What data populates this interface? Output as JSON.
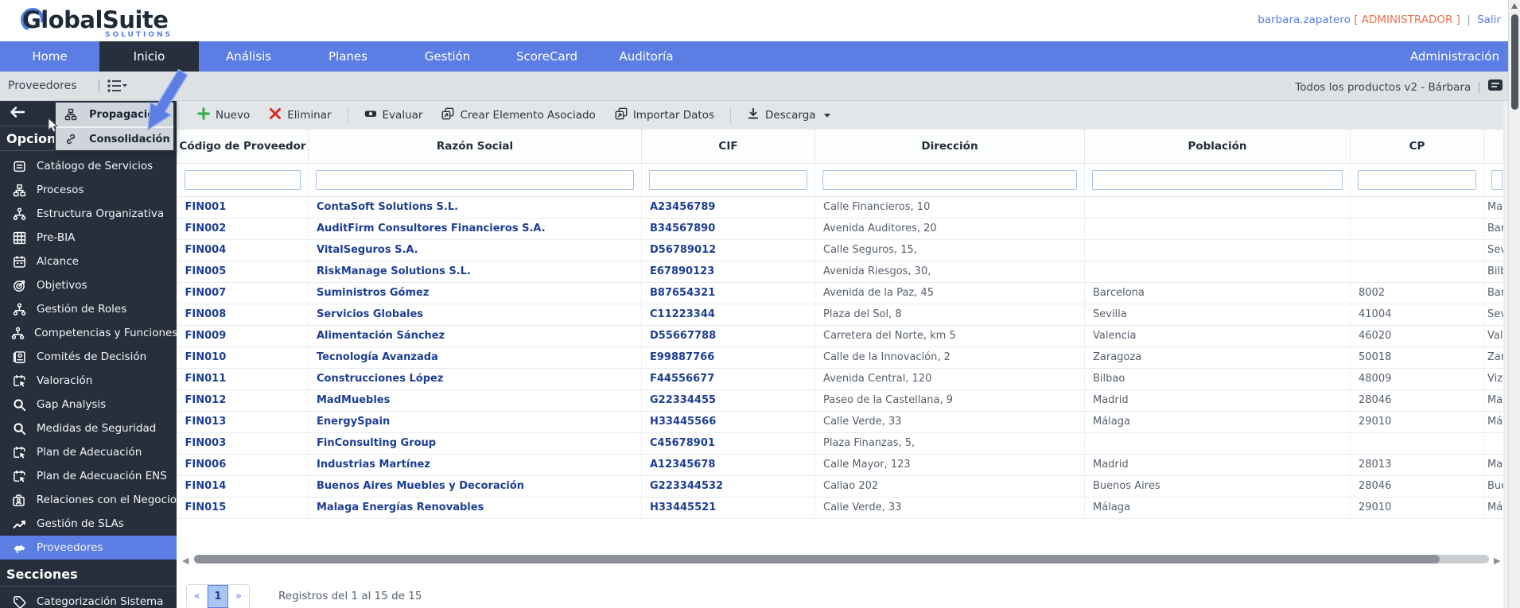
{
  "header": {
    "logo_text": "GlobalSuite",
    "logo_sub": "SOLUTIONS",
    "user": "barbara.zapatero",
    "role_wrapped": "[ ADMINISTRADOR ]",
    "separator": "|",
    "logout": "Salir"
  },
  "nav": {
    "items": [
      {
        "label": "Home",
        "active": false
      },
      {
        "label": "Inicio",
        "active": true
      },
      {
        "label": "Análisis",
        "active": false
      },
      {
        "label": "Planes",
        "active": false
      },
      {
        "label": "Gestión",
        "active": false
      },
      {
        "label": "ScoreCard",
        "active": false
      },
      {
        "label": "Auditoría",
        "active": false
      }
    ],
    "right_item": "Administración"
  },
  "breadcrumb": {
    "title": "Proveedores",
    "separator": "|",
    "context": "Todos los productos v2 - Bárbara",
    "context_separator": "|"
  },
  "context_menu": {
    "items": [
      {
        "label": "Propagación",
        "icon": "sitemap-icon"
      },
      {
        "label": "Consolidación",
        "icon": "link-icon"
      }
    ]
  },
  "sidebar": {
    "sections": [
      {
        "title": "Opciones",
        "items": [
          {
            "label": "Catálogo de Servicios",
            "icon": "document-icon",
            "selected": false
          },
          {
            "label": "Procesos",
            "icon": "sitemap-icon",
            "selected": false
          },
          {
            "label": "Estructura Organizativa",
            "icon": "org-tree-icon",
            "selected": false
          },
          {
            "label": "Pre-BIA",
            "icon": "grid-icon",
            "selected": false
          },
          {
            "label": "Alcance",
            "icon": "calendar-icon",
            "selected": false
          },
          {
            "label": "Objetivos",
            "icon": "target-icon",
            "selected": false
          },
          {
            "label": "Gestión de Roles",
            "icon": "org-tree-icon",
            "selected": false
          },
          {
            "label": "Competencias y Funciones",
            "icon": "org-tree-icon",
            "selected": false
          },
          {
            "label": "Comités de Decisión",
            "icon": "id-card-icon",
            "selected": false
          },
          {
            "label": "Valoración",
            "icon": "calendar-cursor-icon",
            "selected": false
          },
          {
            "label": "Gap Analysis",
            "icon": "magnifier-icon",
            "selected": false
          },
          {
            "label": "Medidas de Seguridad",
            "icon": "magnifier-icon",
            "selected": false
          },
          {
            "label": "Plan de Adecuación",
            "icon": "calendar-cursor-icon",
            "selected": false
          },
          {
            "label": "Plan de Adecuación ENS",
            "icon": "calendar-cursor-icon",
            "selected": false
          },
          {
            "label": "Relaciones con el Negocio",
            "icon": "briefcase-user-icon",
            "selected": false
          },
          {
            "label": "Gestión de SLAs",
            "icon": "chart-line-icon",
            "selected": false
          },
          {
            "label": "Proveedores",
            "icon": "handshake-icon",
            "selected": true
          }
        ]
      },
      {
        "title": "Secciones",
        "items": [
          {
            "label": "Categorización Sistema",
            "icon": "tag-icon",
            "selected": false
          }
        ]
      }
    ]
  },
  "toolbar": {
    "buttons": [
      {
        "label": "Nuevo",
        "icon": "plus-icon"
      },
      {
        "label": "Eliminar",
        "icon": "x-icon"
      },
      {
        "divider": true
      },
      {
        "label": "Evaluar",
        "icon": "evaluate-icon"
      },
      {
        "label": "Crear Elemento Asociado",
        "icon": "copy-arrow-icon"
      },
      {
        "label": "Importar Datos",
        "icon": "copy-arrow-icon"
      },
      {
        "divider": true
      },
      {
        "label": "Descarga",
        "icon": "download-icon",
        "caret": true
      }
    ]
  },
  "table": {
    "columns": [
      "Código de Proveedor",
      "Razón Social",
      "CIF",
      "Dirección",
      "Población",
      "CP",
      ""
    ],
    "rows": [
      [
        "FIN001",
        "ContaSoft Solutions S.L.",
        "A23456789",
        "Calle Financieros, 10",
        "",
        "",
        "Madr"
      ],
      [
        "FIN002",
        "AuditFirm Consultores Financieros S.A.",
        "B34567890",
        "Avenida Auditores, 20",
        "",
        "",
        "Barce"
      ],
      [
        "FIN004",
        "VitalSeguros S.A.",
        "D56789012",
        "Calle Seguros, 15,",
        "",
        "",
        "Sevill"
      ],
      [
        "FIN005",
        "RiskManage Solutions S.L.",
        "E67890123",
        "Avenida Riesgos, 30,",
        "",
        "",
        "Bilba"
      ],
      [
        "FIN007",
        "Suministros Gómez",
        "B87654321",
        "Avenida de la Paz, 45",
        "Barcelona",
        "8002",
        "Barce"
      ],
      [
        "FIN008",
        "Servicios Globales",
        "C11223344",
        "Plaza del Sol, 8",
        "Sevilla",
        "41004",
        "Sevill"
      ],
      [
        "FIN009",
        "Alimentación Sánchez",
        "D55667788",
        "Carretera del Norte, km 5",
        "Valencia",
        "46020",
        "Valen"
      ],
      [
        "FIN010",
        "Tecnología Avanzada",
        "E99887766",
        "Calle de la Innovación, 2",
        "Zaragoza",
        "50018",
        "Zarag"
      ],
      [
        "FIN011",
        "Construcciones López",
        "F44556677",
        "Avenida Central, 120",
        "Bilbao",
        "48009",
        "Vizca"
      ],
      [
        "FIN012",
        "MadMuebles",
        "G22334455",
        "Paseo de la Castellana, 9",
        "Madrid",
        "28046",
        "Madr"
      ],
      [
        "FIN013",
        "EnergySpain",
        "H33445566",
        "Calle Verde, 33",
        "Málaga",
        "29010",
        "Mála"
      ],
      [
        "FIN003",
        "FinConsulting Group",
        "C45678901",
        "Plaza Finanzas, 5,",
        "",
        "",
        ""
      ],
      [
        "FIN006",
        "Industrias Martínez",
        "A12345678",
        "Calle Mayor, 123",
        "Madrid",
        "28013",
        "Madr"
      ],
      [
        "FIN014",
        "Buenos Aires Muebles y Decoración",
        "G223344532",
        "Callao 202",
        "Buenos Aires",
        "28046",
        "Buen"
      ],
      [
        "FIN015",
        "Malaga Energías Renovables",
        "H33445521",
        "Calle Verde, 33",
        "Málaga",
        "29010",
        "Mála"
      ]
    ]
  },
  "pagination": {
    "prev": "«",
    "page": "1",
    "next": "»",
    "summary": "Registros del 1 al 15 de 15"
  },
  "colors": {
    "nav_blue": "#5b7de4",
    "dark_navy": "#272f3c",
    "link_blue": "#1d3e93",
    "role_orange": "#e8724f",
    "new_green": "#3daf4c",
    "delete_red": "#d92b1f",
    "active_page_bg": "#a9c6f3"
  }
}
